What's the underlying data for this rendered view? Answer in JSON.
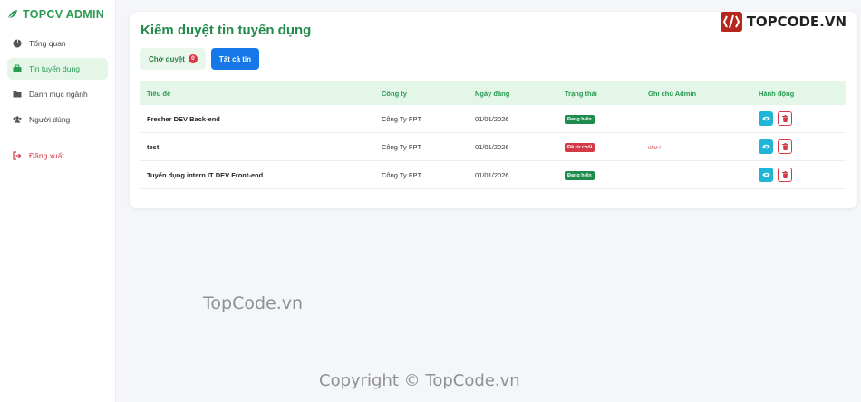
{
  "app": {
    "brand": "TOPCV ADMIN",
    "accent": "#2a9b52"
  },
  "sidebar": {
    "items": [
      {
        "label": "Tổng quan",
        "icon": "pie-chart-icon"
      },
      {
        "label": "Tin tuyển dụng",
        "icon": "briefcase-icon",
        "active": true
      },
      {
        "label": "Danh mục ngành",
        "icon": "folder-icon"
      },
      {
        "label": "Người dùng",
        "icon": "users-icon"
      }
    ],
    "logout": {
      "label": "Đăng xuất",
      "icon": "sign-out-icon"
    }
  },
  "main": {
    "title": "Kiểm duyệt tin tuyển dụng",
    "tabs": {
      "pending_label": "Chờ duyệt",
      "pending_count": "0",
      "all_label": "Tất cả tin"
    },
    "table": {
      "headers": [
        "Tiêu đề",
        "Công ty",
        "Ngày đăng",
        "Trạng thái",
        "Ghi chú Admin",
        "Hành động"
      ],
      "rows": [
        {
          "title": "Fresher DEV Back-end",
          "company": "Công Ty FPT",
          "date": "01/01/2026",
          "status": "Đang hiển",
          "status_color": "#1e8a4c",
          "note": ""
        },
        {
          "title": "test",
          "company": "Công Ty FPT",
          "date": "01/01/2026",
          "status": "Đã từ chối",
          "status_color": "#d33a47",
          "note": "như l"
        },
        {
          "title": "Tuyển dụng intern IT DEV Front-end",
          "company": "Công Ty FPT",
          "date": "01/01/2026",
          "status": "Đang hiển",
          "status_color": "#1e8a4c",
          "note": ""
        }
      ]
    }
  },
  "watermarks": {
    "top": "TOPCODE.VN",
    "middle": "TopCode.vn",
    "bottom": "Copyright © TopCode.vn"
  }
}
